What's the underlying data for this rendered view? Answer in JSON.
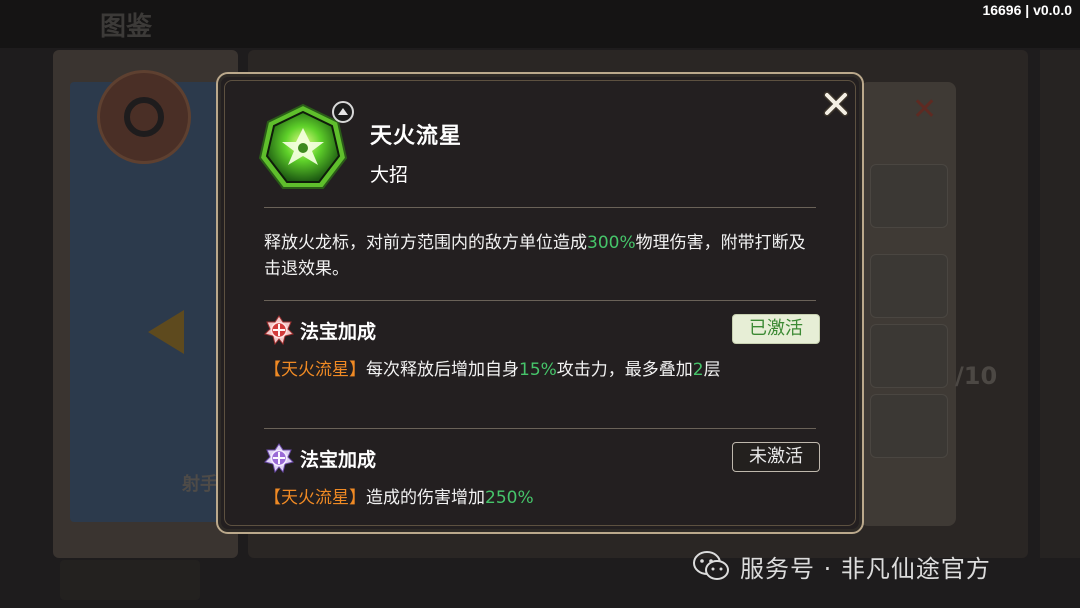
{
  "version_label": "16696 | v0.0.0",
  "background": {
    "back_title": "图鉴",
    "archer_label": "射手",
    "ratio_text": "/10"
  },
  "popup": {
    "skill": {
      "name": "天火流星",
      "type": "大招",
      "icon": "shuriken-icon",
      "upgrade_badge_icon": "chevron-up-icon",
      "description_parts": [
        "释放火龙标，对前方范围内的敌方单位造成",
        "300%",
        "物理伤害，附带打断及击退效果。"
      ]
    },
    "bonuses": [
      {
        "icon": "treasure-red-icon",
        "title": "法宝加成",
        "status": "已激活",
        "text_parts": [
          "【天火流星】",
          "每次释放后增加自身",
          "15%",
          "攻击力，最多叠加",
          "2",
          "层"
        ]
      },
      {
        "icon": "treasure-purple-icon",
        "title": "法宝加成",
        "status": "未激活",
        "text_parts": [
          "【天火流星】",
          "造成的伤害增加",
          "250%"
        ]
      }
    ]
  },
  "watermark": {
    "text": "服务号 · 非凡仙途官方",
    "icon": "wechat-icon"
  },
  "colors": {
    "highlight_green": "#46c46a",
    "skill_name_orange": "#f08a24",
    "frame_gold": "#bba98c"
  }
}
